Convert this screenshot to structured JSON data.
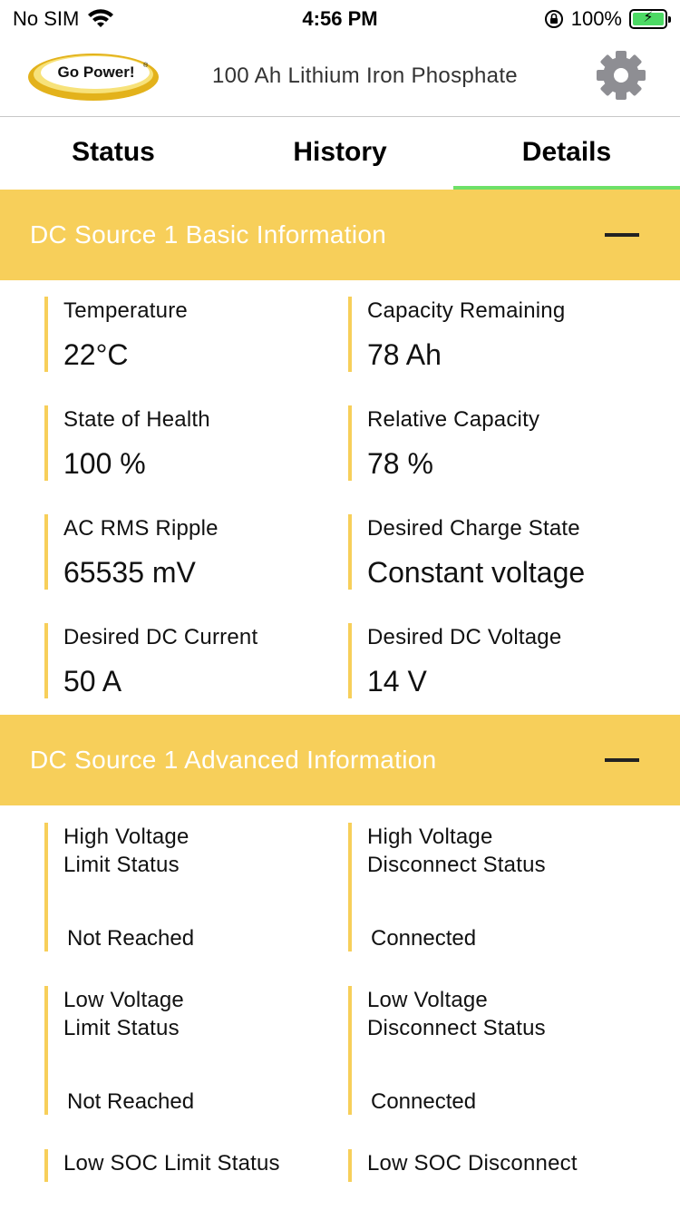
{
  "status_bar": {
    "carrier": "No SIM",
    "time": "4:56 PM",
    "battery_percent": "100%",
    "battery_color": "#4cd964"
  },
  "header": {
    "logo_text": "Go Power!",
    "logo_registered": "®",
    "title": "100 Ah Lithium Iron Phosphate",
    "settings_icon": "gear-icon"
  },
  "tabs": [
    {
      "label": "Status"
    },
    {
      "label": "History"
    },
    {
      "label": "Details",
      "active": true
    }
  ],
  "basic": {
    "title": "DC Source 1 Basic Information",
    "fields": [
      {
        "label": "Temperature",
        "value": "22°C"
      },
      {
        "label": "Capacity Remaining",
        "value": "78 Ah"
      },
      {
        "label": "State of Health",
        "value": "100 %"
      },
      {
        "label": "Relative Capacity",
        "value": "78 %"
      },
      {
        "label": "AC RMS Ripple",
        "value": "65535 mV"
      },
      {
        "label": "Desired Charge State",
        "value": "Constant voltage"
      },
      {
        "label": "Desired DC Current",
        "value": "50 A"
      },
      {
        "label": "Desired DC Voltage",
        "value": "14 V"
      }
    ]
  },
  "advanced": {
    "title": "DC Source 1 Advanced Information",
    "fields": [
      {
        "label": "High Voltage\nLimit Status",
        "value": "Not Reached"
      },
      {
        "label": "High Voltage\nDisconnect Status",
        "value": "Connected"
      },
      {
        "label": "Low Voltage\nLimit Status",
        "value": "Not Reached"
      },
      {
        "label": "Low Voltage\nDisconnect Status",
        "value": "Connected"
      },
      {
        "label": "Low SOC Limit Status",
        "value": ""
      },
      {
        "label": "Low SOC Disconnect",
        "value": ""
      }
    ]
  },
  "colors": {
    "section_bg": "#f7cf5a",
    "tab_indicator": "#6ee068",
    "gear": "#8e8e93"
  }
}
